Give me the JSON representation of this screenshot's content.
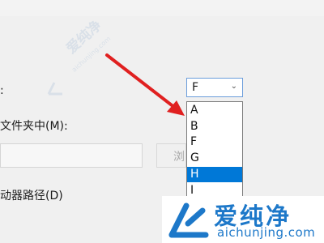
{
  "dialog": {
    "drive_label_suffix": ":",
    "folder_label": "文件夹中(M):",
    "path_value": "",
    "browse_label": "浏",
    "drive_path_label": "动器路径(D)"
  },
  "drive_select": {
    "selected": "F",
    "chevron_icon": "chevron-down-icon",
    "options": [
      "A",
      "B",
      "F",
      "G",
      "H",
      "I"
    ],
    "highlighted": "H"
  },
  "watermark": {
    "brand": "爱纯净",
    "domain": "aichunjing.com",
    "domain_faded": "aichunjing.com"
  },
  "colors": {
    "dialog_bg": "#f0f0f0",
    "selection": "#0078d7",
    "arrow": "#e02020",
    "brand": "#1d78c9"
  }
}
